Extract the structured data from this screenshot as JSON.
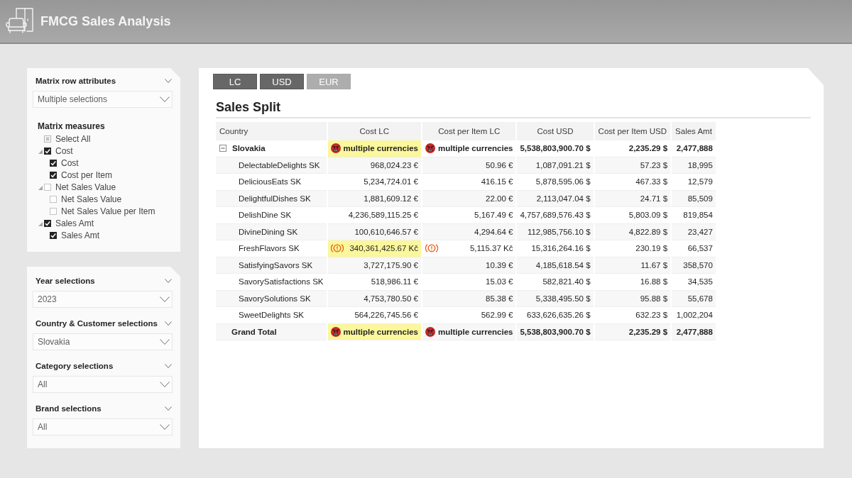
{
  "header": {
    "title": "FMCG Sales Analysis"
  },
  "filters": {
    "row_attributes": {
      "label": "Matrix row attributes",
      "value": "Multiple selections"
    },
    "measures": {
      "label": "Matrix measures",
      "items": [
        {
          "label": "Select All",
          "checked": false,
          "indeterminate": true
        },
        {
          "label": "Cost",
          "checked": true,
          "indeterminate": false,
          "expanded": true,
          "children": [
            {
              "label": "Cost",
              "checked": true,
              "indeterminate": false
            },
            {
              "label": "Cost per Item",
              "checked": true,
              "indeterminate": false
            }
          ]
        },
        {
          "label": "Net Sales Value",
          "checked": false,
          "indeterminate": false,
          "expanded": true,
          "children": [
            {
              "label": "Net Sales Value",
              "checked": false,
              "indeterminate": false
            },
            {
              "label": "Net Sales Value per Item",
              "checked": false,
              "indeterminate": false
            }
          ]
        },
        {
          "label": "Sales Amt",
          "checked": true,
          "indeterminate": false,
          "expanded": true,
          "children": [
            {
              "label": "Sales Amt",
              "checked": true,
              "indeterminate": false
            }
          ]
        }
      ]
    },
    "slicers": [
      {
        "label": "Year selections",
        "value": "2023"
      },
      {
        "label": "Country & Customer selections",
        "value": "Slovakia"
      },
      {
        "label": "Category selections",
        "value": "All"
      },
      {
        "label": "Brand selections",
        "value": "All"
      }
    ]
  },
  "currency_buttons": [
    {
      "label": "LC",
      "selected": true
    },
    {
      "label": "USD",
      "selected": true
    },
    {
      "label": "EUR",
      "selected": false
    }
  ],
  "matrix": {
    "title": "Sales Split",
    "columns": [
      "Country",
      "Cost LC",
      "Cost per Item LC",
      "Cost USD",
      "Cost per Item USD",
      "Sales Amt"
    ],
    "groups": [
      {
        "label": "Slovakia",
        "expanded": true,
        "cells": [
          {
            "kind": "error",
            "text": "multiple currencies",
            "highlighted": true
          },
          {
            "kind": "error",
            "text": "multiple currencies",
            "highlighted": false
          },
          {
            "kind": "plain",
            "text": "5,538,803,900.70 $",
            "highlighted": false
          },
          {
            "kind": "plain",
            "text": "2,235.29 $",
            "highlighted": false
          },
          {
            "kind": "plain",
            "text": "2,477,888",
            "highlighted": false
          }
        ],
        "rows": [
          {
            "label": "DelectableDelights SK",
            "cells": [
              {
                "kind": "plain",
                "text": "968,024.23 €",
                "highlighted": false
              },
              {
                "kind": "plain",
                "text": "50.96 €",
                "highlighted": false
              },
              {
                "kind": "plain",
                "text": "1,087,091.21 $",
                "highlighted": false
              },
              {
                "kind": "plain",
                "text": "57.23 $",
                "highlighted": false
              },
              {
                "kind": "plain",
                "text": "18,995",
                "highlighted": false
              }
            ]
          },
          {
            "label": "DeliciousEats SK",
            "cells": [
              {
                "kind": "plain",
                "text": "5,234,724.01 €",
                "highlighted": false
              },
              {
                "kind": "plain",
                "text": "416.15 €",
                "highlighted": false
              },
              {
                "kind": "plain",
                "text": "5,878,595.06 $",
                "highlighted": false
              },
              {
                "kind": "plain",
                "text": "467.33 $",
                "highlighted": false
              },
              {
                "kind": "plain",
                "text": "12,579",
                "highlighted": false
              }
            ]
          },
          {
            "label": "DelightfulDishes SK",
            "cells": [
              {
                "kind": "plain",
                "text": "1,881,609.12 €",
                "highlighted": false
              },
              {
                "kind": "plain",
                "text": "22.00 €",
                "highlighted": false
              },
              {
                "kind": "plain",
                "text": "2,113,047.04 $",
                "highlighted": false
              },
              {
                "kind": "plain",
                "text": "24.71 $",
                "highlighted": false
              },
              {
                "kind": "plain",
                "text": "85,509",
                "highlighted": false
              }
            ]
          },
          {
            "label": "DelishDine SK",
            "cells": [
              {
                "kind": "plain",
                "text": "4,236,589,115.25 €",
                "highlighted": false
              },
              {
                "kind": "plain",
                "text": "5,167.49 €",
                "highlighted": false
              },
              {
                "kind": "plain",
                "text": "4,757,689,576.43 $",
                "highlighted": false
              },
              {
                "kind": "plain",
                "text": "5,803.09 $",
                "highlighted": false
              },
              {
                "kind": "plain",
                "text": "819,854",
                "highlighted": false
              }
            ]
          },
          {
            "label": "DivineDining SK",
            "cells": [
              {
                "kind": "plain",
                "text": "100,610,646.57 €",
                "highlighted": false
              },
              {
                "kind": "plain",
                "text": "4,294.64 €",
                "highlighted": false
              },
              {
                "kind": "plain",
                "text": "112,985,756.10 $",
                "highlighted": false
              },
              {
                "kind": "plain",
                "text": "4,822.89 $",
                "highlighted": false
              },
              {
                "kind": "plain",
                "text": "23,427",
                "highlighted": false
              }
            ]
          },
          {
            "label": "FreshFlavors SK",
            "cells": [
              {
                "kind": "warning",
                "text": "340,361,425.67 Kč",
                "highlighted": true
              },
              {
                "kind": "warning",
                "text": "5,115.37 Kč",
                "highlighted": false
              },
              {
                "kind": "plain",
                "text": "15,316,264.16 $",
                "highlighted": false
              },
              {
                "kind": "plain",
                "text": "230.19 $",
                "highlighted": false
              },
              {
                "kind": "plain",
                "text": "66,537",
                "highlighted": false
              }
            ]
          },
          {
            "label": "SatisfyingSavors SK",
            "cells": [
              {
                "kind": "plain",
                "text": "3,727,175.90 €",
                "highlighted": false
              },
              {
                "kind": "plain",
                "text": "10.39 €",
                "highlighted": false
              },
              {
                "kind": "plain",
                "text": "4,185,618.54 $",
                "highlighted": false
              },
              {
                "kind": "plain",
                "text": "11.67 $",
                "highlighted": false
              },
              {
                "kind": "plain",
                "text": "358,570",
                "highlighted": false
              }
            ]
          },
          {
            "label": "SavorySatisfactions SK",
            "cells": [
              {
                "kind": "plain",
                "text": "518,986.11 €",
                "highlighted": false
              },
              {
                "kind": "plain",
                "text": "15.03 €",
                "highlighted": false
              },
              {
                "kind": "plain",
                "text": "582,821.40 $",
                "highlighted": false
              },
              {
                "kind": "plain",
                "text": "16.88 $",
                "highlighted": false
              },
              {
                "kind": "plain",
                "text": "34,535",
                "highlighted": false
              }
            ]
          },
          {
            "label": "SavorySolutions SK",
            "cells": [
              {
                "kind": "plain",
                "text": "4,753,780.50 €",
                "highlighted": false
              },
              {
                "kind": "plain",
                "text": "85.38 €",
                "highlighted": false
              },
              {
                "kind": "plain",
                "text": "5,338,495.50 $",
                "highlighted": false
              },
              {
                "kind": "plain",
                "text": "95.88 $",
                "highlighted": false
              },
              {
                "kind": "plain",
                "text": "55,678",
                "highlighted": false
              }
            ]
          },
          {
            "label": "SweetDelights SK",
            "cells": [
              {
                "kind": "plain",
                "text": "564,226,745.56 €",
                "highlighted": false
              },
              {
                "kind": "plain",
                "text": "562.99 €",
                "highlighted": false
              },
              {
                "kind": "plain",
                "text": "633,626,635.26 $",
                "highlighted": false
              },
              {
                "kind": "plain",
                "text": "632.23 $",
                "highlighted": false
              },
              {
                "kind": "plain",
                "text": "1,002,204",
                "highlighted": false
              }
            ]
          }
        ]
      }
    ],
    "grand_total": {
      "label": "Grand Total",
      "cells": [
        {
          "kind": "error",
          "text": "multiple currencies",
          "highlighted": true
        },
        {
          "kind": "error",
          "text": "multiple currencies",
          "highlighted": false
        },
        {
          "kind": "plain",
          "text": "5,538,803,900.70 $",
          "highlighted": false
        },
        {
          "kind": "plain",
          "text": "2,235.29 $",
          "highlighted": false
        },
        {
          "kind": "plain",
          "text": "2,477,888",
          "highlighted": false
        }
      ]
    }
  }
}
